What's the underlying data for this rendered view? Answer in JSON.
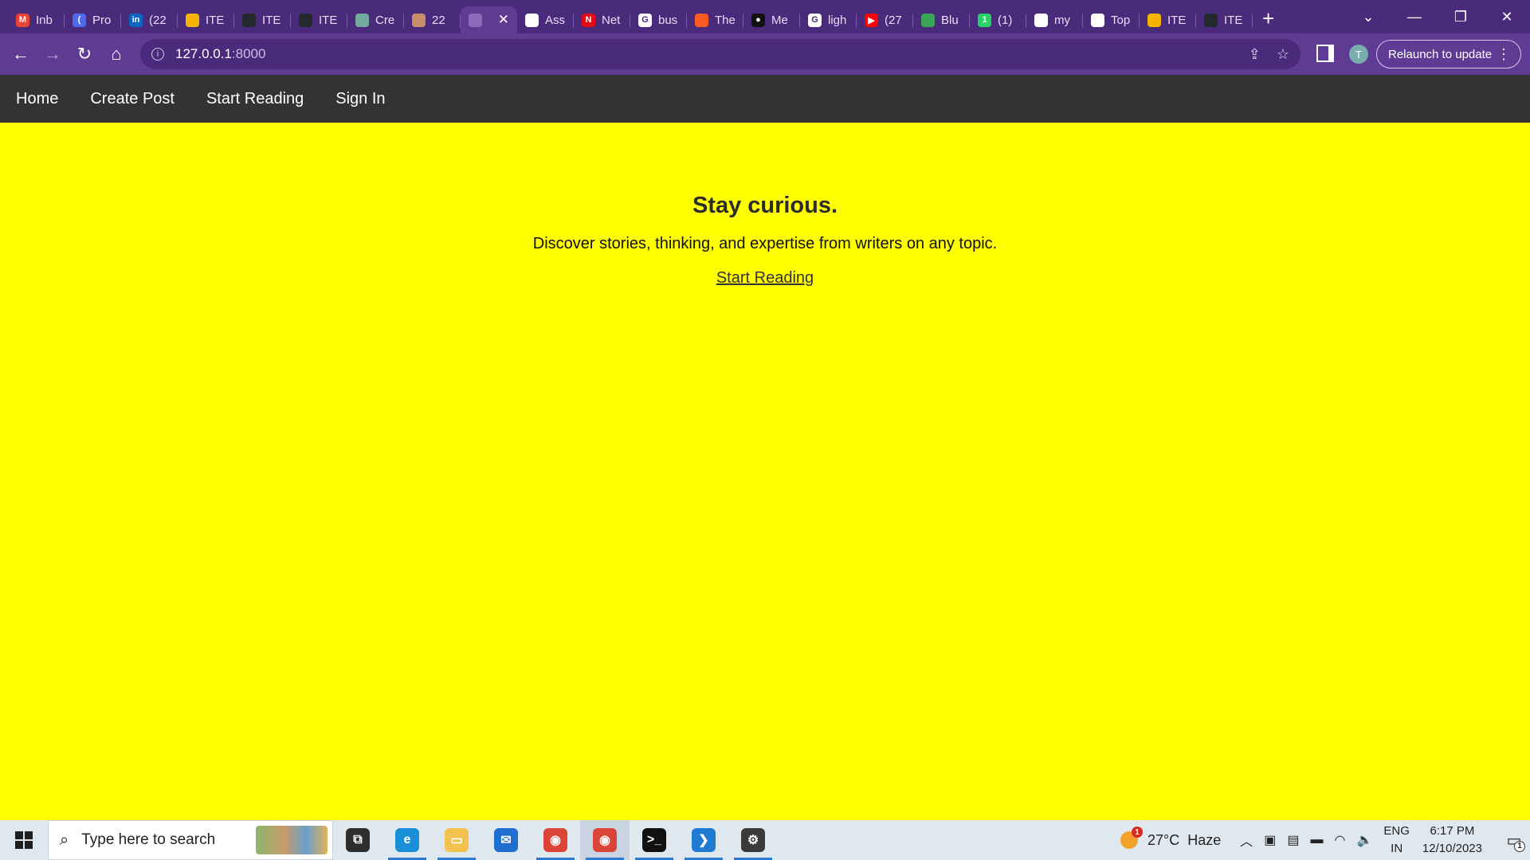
{
  "browser": {
    "tabs": [
      {
        "title": "Inb",
        "icon": "gmail-icon",
        "color": "#ea4335",
        "glyph": "M",
        "active": false
      },
      {
        "title": "Pro",
        "icon": "arc-icon",
        "color": "#4f6bed",
        "glyph": "(",
        "active": false
      },
      {
        "title": "(22",
        "icon": "linkedin-icon",
        "color": "#0a66c2",
        "glyph": "in",
        "active": false
      },
      {
        "title": "ITE",
        "icon": "notes-icon",
        "color": "#f4b400",
        "glyph": "",
        "active": false
      },
      {
        "title": "ITE",
        "icon": "github-icon",
        "color": "#24292e",
        "glyph": "",
        "active": false
      },
      {
        "title": "ITE",
        "icon": "github-icon",
        "color": "#24292e",
        "glyph": "",
        "active": false
      },
      {
        "title": "Cre",
        "icon": "chatgpt-icon",
        "color": "#74aa9c",
        "glyph": "",
        "active": false
      },
      {
        "title": "22",
        "icon": "avatar-icon",
        "color": "#c98f6a",
        "glyph": "",
        "active": false
      },
      {
        "title": "",
        "icon": "globe-icon",
        "color": "#8a6cb8",
        "glyph": "",
        "active": true
      },
      {
        "title": "Ass",
        "icon": "arc-icon",
        "color": "#ffffff",
        "glyph": "",
        "active": false
      },
      {
        "title": "Net",
        "icon": "netflix-icon",
        "color": "#e50914",
        "glyph": "N",
        "active": false
      },
      {
        "title": "bus",
        "icon": "google-icon",
        "color": "#ffffff",
        "glyph": "G",
        "active": false
      },
      {
        "title": "The",
        "icon": "square-icon",
        "color": "#ff5a1f",
        "glyph": "",
        "active": false
      },
      {
        "title": "Me",
        "icon": "medium-icon",
        "color": "#111111",
        "glyph": "●",
        "active": false
      },
      {
        "title": "ligh",
        "icon": "google-icon",
        "color": "#ffffff",
        "glyph": "G",
        "active": false
      },
      {
        "title": "(27",
        "icon": "youtube-icon",
        "color": "#ff0000",
        "glyph": "▶",
        "active": false
      },
      {
        "title": "Blu",
        "icon": "book-icon",
        "color": "#3aa655",
        "glyph": "",
        "active": false
      },
      {
        "title": "(1)",
        "icon": "whatsapp-icon",
        "color": "#25d366",
        "glyph": "1",
        "active": false
      },
      {
        "title": "my",
        "icon": "arc-icon",
        "color": "#ffffff",
        "glyph": "",
        "active": false
      },
      {
        "title": "Top",
        "icon": "arc-icon",
        "color": "#ffffff",
        "glyph": "",
        "active": false
      },
      {
        "title": "ITE",
        "icon": "notes-icon",
        "color": "#f4b400",
        "glyph": "",
        "active": false
      },
      {
        "title": "ITE",
        "icon": "github-icon",
        "color": "#24292e",
        "glyph": "",
        "active": false
      }
    ],
    "url_host": "127.0.0.1",
    "url_port": ":8000",
    "profile_initial": "T",
    "relaunch_label": "Relaunch to update"
  },
  "navbar": {
    "items": [
      "Home",
      "Create Post",
      "Start Reading",
      "Sign In"
    ]
  },
  "hero": {
    "title": "Stay curious.",
    "subtitle": "Discover stories, thinking, and expertise from writers on any topic.",
    "link": "Start Reading"
  },
  "taskbar": {
    "search_placeholder": "Type here to search",
    "apps": [
      {
        "name": "task-view-icon",
        "color": "#2d2d2d",
        "glyph": "⧉",
        "open": false
      },
      {
        "name": "edge-icon",
        "color": "#1a8fd8",
        "glyph": "e",
        "open": true
      },
      {
        "name": "file-explorer-icon",
        "color": "#f2c14e",
        "glyph": "▭",
        "open": true
      },
      {
        "name": "mail-icon",
        "color": "#1f6fd1",
        "glyph": "✉",
        "open": false
      },
      {
        "name": "chrome-icon",
        "color": "#db4437",
        "glyph": "◉",
        "open": true
      },
      {
        "name": "chrome-icon",
        "color": "#db4437",
        "glyph": "◉",
        "open": true,
        "focused": true
      },
      {
        "name": "terminal-icon",
        "color": "#111111",
        "glyph": ">_",
        "open": true
      },
      {
        "name": "vscode-icon",
        "color": "#1f7ad1",
        "glyph": "❯",
        "open": true
      },
      {
        "name": "settings-icon",
        "color": "#3a3a3a",
        "glyph": "⚙",
        "open": true
      }
    ],
    "weather_temp": "27°C",
    "weather_cond": "Haze",
    "weather_badge": "1",
    "lang_top": "ENG",
    "lang_bottom": "IN",
    "time": "6:17 PM",
    "date": "12/10/2023",
    "notif_count": "1"
  }
}
